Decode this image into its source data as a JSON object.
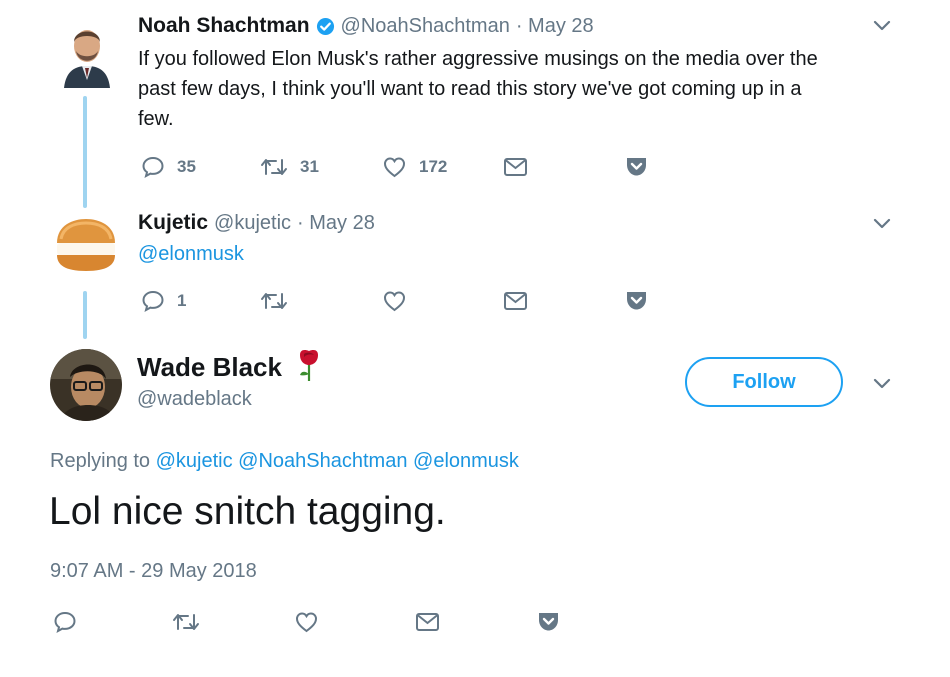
{
  "tweet1": {
    "name": "Noah Shachtman",
    "handle": "@NoahShachtman",
    "date": "· May 28",
    "text_lines": [
      "If you followed Elon Musk's rather aggressive musings on the media over the",
      "past few days, I think you'll want to read this story we've got coming up in a",
      "few."
    ],
    "reply_count": "35",
    "retweet_count": "31",
    "like_count": "172"
  },
  "tweet2": {
    "name": "Kujetic",
    "handle": "@kujetic",
    "date": "· May 28",
    "text": "@elonmusk",
    "reply_count": "1"
  },
  "main_tweet": {
    "name": "Wade Black",
    "handle": "@wadeblack",
    "follow_label": "Follow",
    "replying_prefix": "Replying to",
    "replying_mentions": "@kujetic @NoahShachtman @elonmusk",
    "text": "Lol nice snitch tagging.",
    "timestamp": "9:07 AM - 29 May 2018"
  },
  "colors": {
    "accent": "#1da1f2",
    "link": "#1b95e0",
    "muted": "#657786",
    "thread_line": "#9fd4f0",
    "verified": "#1da1f2",
    "rose": "#d0021b"
  },
  "icons": {
    "verified": "verified-badge-icon",
    "reply": "reply-icon",
    "retweet": "retweet-icon",
    "like": "heart-icon",
    "dm": "envelope-icon",
    "pocket": "pocket-icon",
    "more": "chevron-down-icon"
  }
}
